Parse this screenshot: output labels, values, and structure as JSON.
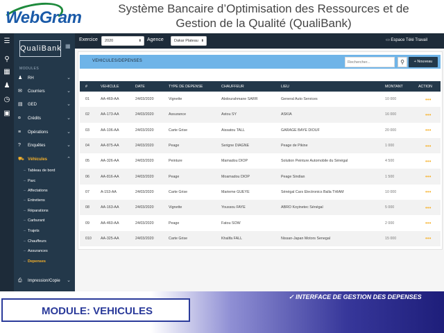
{
  "logo": {
    "text": "WebGram"
  },
  "slide_title_line1": "Système Bancaire d’Optimisation des Ressources et de",
  "slide_title_line2": "Gestion de la Qualité (QualiBank)",
  "brand": "QualiBank",
  "modules_label": "MODULES",
  "nav": [
    {
      "label": "RH",
      "icon": "group-icon"
    },
    {
      "label": "Courriers",
      "icon": "mail-icon"
    },
    {
      "label": "GED",
      "icon": "folder-icon"
    },
    {
      "label": "Crédits",
      "icon": "money-icon"
    },
    {
      "label": "Opérations",
      "icon": "list-icon"
    },
    {
      "label": "Enquêtes",
      "icon": "help-icon"
    },
    {
      "label": "Véhicules",
      "icon": "car-icon"
    }
  ],
  "subnav": [
    "Tableau de bord",
    "Parc",
    "Affectations",
    "Entretiens",
    "Réparations",
    "Carburant",
    "Trajets",
    "Chauffeurs",
    "Assurances",
    "Depenses"
  ],
  "nav_bottom": {
    "label": "Impression/Copie",
    "icon": "print-icon"
  },
  "topbar": {
    "exercice_label": "Exercice",
    "exercice_value": "2020",
    "agence_label": "Agence",
    "agence_value": "Dakar Plateau",
    "workspace": "Espace Télé Travail"
  },
  "panel": {
    "title": "VEHICULES/DEPENSES",
    "search_placeholder": "Rechercher...",
    "new_button": "+ Nouveau"
  },
  "table": {
    "headers": [
      "#",
      "VEHICULE",
      "DATE",
      "TYPE DE DEPENSE",
      "CHAUFFEUR",
      "LIEU",
      "MONTANT",
      "ACTION"
    ],
    "rows": [
      [
        "01",
        "AA-469-AA",
        "24/03/2020",
        "Vignette",
        "Abdourahmane SARR",
        "General Auto Services",
        "10 000"
      ],
      [
        "02",
        "AA-173-AA",
        "24/03/2020",
        "Assurance",
        "Astou SY",
        "ASKIA",
        "16 000"
      ],
      [
        "03",
        "AA-106-AA",
        "24/03/2020",
        "Carte Grise",
        "Aissatou TALL",
        "GARAGE BAYE DIOUF",
        "20 000"
      ],
      [
        "04",
        "AA-875-AA",
        "24/03/2020",
        "Peage",
        "Serigne DIAGNE",
        "Peage de Pikine",
        "1 000"
      ],
      [
        "05",
        "AA-326-AA",
        "24/03/2020",
        "Peinture",
        "Mamadou DIOP",
        "Solution Peinture Automobile du Sénégal",
        "4 500"
      ],
      [
        "06",
        "AA-816-AA",
        "24/03/2020",
        "Peage",
        "Moamadou DIOP",
        "Peage Sindian",
        "1 500"
      ],
      [
        "07",
        "A-153-AA",
        "24/03/2020",
        "Carte Grise",
        "Marieme GUEYE",
        "Sénégal Cars Electronics Balla THIAM",
        "10 000"
      ],
      [
        "08",
        "AA-163-AA",
        "24/03/2020",
        "Vignette",
        "Youssou FAYE",
        "ABRO Koyinetec Sénégal",
        "5 000"
      ],
      [
        "09",
        "AA-460-AA",
        "24/03/2020",
        "Peage",
        "Fatou SOW",
        "",
        "2 000"
      ],
      [
        "010",
        "AA-325-AA",
        "24/03/2020",
        "Carte Grise",
        "Khalifa FALL",
        "Nissan-Japan Motors Senegal",
        "15 000"
      ]
    ],
    "action_glyph": "•••"
  },
  "footer": {
    "module": "MODULE: VEHICULES",
    "caption": "INTERFACE  DE  GESTION  DES  DEPENSES"
  },
  "colors": {
    "sidebar": "#23384a",
    "accent": "#f6b12a",
    "header_blue": "#6fb4e8",
    "module_blue": "#2a3a9a"
  }
}
